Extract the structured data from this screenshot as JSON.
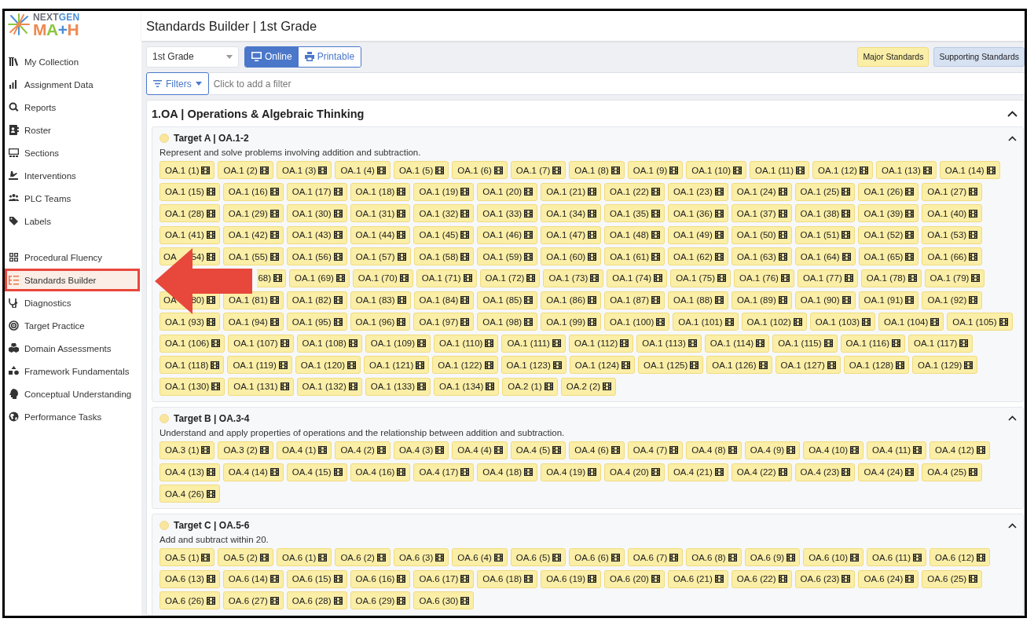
{
  "logo": {
    "top": [
      "NEXT",
      "GEN"
    ],
    "mark": "MA+H"
  },
  "sidebar": {
    "sections": [
      {
        "items": [
          {
            "label": "My Collection",
            "selected": false
          },
          {
            "label": "Assignment Data",
            "selected": false
          },
          {
            "label": "Reports",
            "selected": false
          },
          {
            "label": "Roster",
            "selected": false
          },
          {
            "label": "Sections",
            "selected": false
          },
          {
            "label": "Interventions",
            "selected": false
          },
          {
            "label": "PLC Teams",
            "selected": false
          },
          {
            "label": "Labels",
            "selected": false
          }
        ]
      },
      {
        "items": [
          {
            "label": "Procedural Fluency",
            "selected": false
          },
          {
            "label": "Standards Builder",
            "selected": true,
            "callout": true
          },
          {
            "label": "Diagnostics",
            "selected": false
          },
          {
            "label": "Target Practice",
            "selected": false
          },
          {
            "label": "Domain Assessments",
            "selected": false
          },
          {
            "label": "Framework Fundamentals",
            "selected": false
          },
          {
            "label": "Conceptual Understanding",
            "selected": false
          },
          {
            "label": "Performance Tasks",
            "selected": false
          }
        ]
      }
    ]
  },
  "page_title": "Standards Builder | 1st Grade",
  "grade_select": {
    "value": "1st Grade"
  },
  "view_options": [
    {
      "label": "Online",
      "selected": true
    },
    {
      "label": "Printable",
      "selected": false
    }
  ],
  "legend": [
    {
      "label": "Major Standards",
      "kind": "major"
    },
    {
      "label": "Supporting Standards",
      "kind": "supporting"
    }
  ],
  "filters": {
    "button": "Filters",
    "placeholder": "Click to add a filter"
  },
  "domain": {
    "title": "1.OA | Operations & Algebraic Thinking",
    "expanded": true,
    "targets": [
      {
        "title": "Target A | OA.1-2",
        "expanded": true,
        "description": "Represent and solve problems involving addition and subtraction.",
        "chips": [
          "OA.1 (1)",
          "OA.1 (2)",
          "OA.1 (3)",
          "OA.1 (4)",
          "OA.1 (5)",
          "OA.1 (6)",
          "OA.1 (7)",
          "OA.1 (8)",
          "OA.1 (9)",
          "OA.1 (10)",
          "OA.1 (11)",
          "OA.1 (12)",
          "OA.1 (13)",
          "OA.1 (14)",
          "OA.1 (15)",
          "OA.1 (16)",
          "OA.1 (17)",
          "OA.1 (18)",
          "OA.1 (19)",
          "OA.1 (20)",
          "OA.1 (21)",
          "OA.1 (22)",
          "OA.1 (23)",
          "OA.1 (24)",
          "OA.1 (25)",
          "OA.1 (26)",
          "OA.1 (27)",
          "OA.1 (28)",
          "OA.1 (29)",
          "OA.1 (30)",
          "OA.1 (31)",
          "OA.1 (32)",
          "OA.1 (33)",
          "OA.1 (34)",
          "OA.1 (35)",
          "OA.1 (36)",
          "OA.1 (37)",
          "OA.1 (38)",
          "OA.1 (39)",
          "OA.1 (40)",
          "OA.1 (41)",
          "OA.1 (42)",
          "OA.1 (43)",
          "OA.1 (44)",
          "OA.1 (45)",
          "OA.1 (46)",
          "OA.1 (47)",
          "OA.1 (48)",
          "OA.1 (49)",
          "OA.1 (50)",
          "OA.1 (51)",
          "OA.1 (52)",
          "OA.1 (53)",
          {
            "kind": "covered",
            "left": "OA",
            "right": "54)"
          },
          "OA.1 (55)",
          "OA.1 (56)",
          "OA.1 (57)",
          "OA.1 (58)",
          "OA.1 (59)",
          "OA.1 (60)",
          "OA.1 (61)",
          "OA.1 (62)",
          "OA.1 (63)",
          "OA.1 (64)",
          "OA.1 (65)",
          "OA.1 (66)",
          {
            "kind": "hidden"
          },
          {
            "kind": "covered",
            "right": "68)"
          },
          "OA.1 (69)",
          "OA.1 (70)",
          "OA.1 (71)",
          "OA.1 (72)",
          "OA.1 (73)",
          "OA.1 (74)",
          "OA.1 (75)",
          "OA.1 (76)",
          "OA.1 (77)",
          "OA.1 (78)",
          "OA.1 (79)",
          {
            "kind": "covered",
            "left": "OA",
            "right": "80)"
          },
          "OA.1 (81)",
          "OA.1 (82)",
          "OA.1 (83)",
          "OA.1 (84)",
          "OA.1 (85)",
          "OA.1 (86)",
          "OA.1 (87)",
          "OA.1 (88)",
          "OA.1 (89)",
          "OA.1 (90)",
          "OA.1 (91)",
          "OA.1 (92)",
          "OA.1 (93)",
          "OA.1 (94)",
          "OA.1 (95)",
          "OA.1 (96)",
          "OA.1 (97)",
          "OA.1 (98)",
          "OA.1 (99)",
          "OA.1 (100)",
          "OA.1 (101)",
          "OA.1 (102)",
          "OA.1 (103)",
          "OA.1 (104)",
          "OA.1 (105)",
          "OA.1 (106)",
          "OA.1 (107)",
          "OA.1 (108)",
          "OA.1 (109)",
          "OA.1 (110)",
          "OA.1 (111)",
          "OA.1 (112)",
          "OA.1 (113)",
          "OA.1 (114)",
          "OA.1 (115)",
          "OA.1 (116)",
          "OA.1 (117)",
          "OA.1 (118)",
          "OA.1 (119)",
          "OA.1 (120)",
          "OA.1 (121)",
          "OA.1 (122)",
          "OA.1 (123)",
          "OA.1 (124)",
          "OA.1 (125)",
          "OA.1 (126)",
          "OA.1 (127)",
          "OA.1 (128)",
          "OA.1 (129)",
          "OA.1 (130)",
          "OA.1 (131)",
          "OA.1 (132)",
          "OA.1 (133)",
          "OA.1 (134)",
          "OA.2 (1)",
          "OA.2 (2)"
        ]
      },
      {
        "title": "Target B | OA.3-4",
        "expanded": true,
        "description": "Understand and apply properties of operations and the relationship between addition and subtraction.",
        "chips": [
          "OA.3 (1)",
          "OA.3 (2)",
          "OA.4 (1)",
          "OA.4 (2)",
          "OA.4 (3)",
          "OA.4 (4)",
          "OA.4 (5)",
          "OA.4 (6)",
          "OA.4 (7)",
          "OA.4 (8)",
          "OA.4 (9)",
          "OA.4 (10)",
          "OA.4 (11)",
          "OA.4 (12)",
          "OA.4 (13)",
          "OA.4 (14)",
          "OA.4 (15)",
          "OA.4 (16)",
          "OA.4 (17)",
          "OA.4 (18)",
          "OA.4 (19)",
          "OA.4 (20)",
          "OA.4 (21)",
          "OA.4 (22)",
          "OA.4 (23)",
          "OA.4 (24)",
          "OA.4 (25)",
          "OA.4 (26)"
        ]
      },
      {
        "title": "Target C | OA.5-6",
        "expanded": true,
        "description": "Add and subtract within 20.",
        "chips": [
          "OA.5 (1)",
          "OA.5 (2)",
          "OA.6 (1)",
          "OA.6 (2)",
          "OA.6 (3)",
          "OA.6 (4)",
          "OA.6 (5)",
          "OA.6 (6)",
          "OA.6 (7)",
          "OA.6 (8)",
          "OA.6 (9)",
          "OA.6 (10)",
          "OA.6 (11)",
          "OA.6 (12)",
          "OA.6 (13)",
          "OA.6 (14)",
          "OA.6 (15)",
          "OA.6 (16)",
          "OA.6 (17)",
          "OA.6 (18)",
          "OA.6 (19)",
          "OA.6 (20)",
          "OA.6 (21)",
          "OA.6 (22)",
          "OA.6 (23)",
          "OA.6 (24)",
          "OA.6 (25)",
          "OA.6 (26)",
          "OA.6 (27)",
          "OA.6 (28)",
          "OA.6 (29)",
          "OA.6 (30)"
        ]
      }
    ]
  },
  "annotations": [
    {
      "kind": "arrow"
    }
  ]
}
